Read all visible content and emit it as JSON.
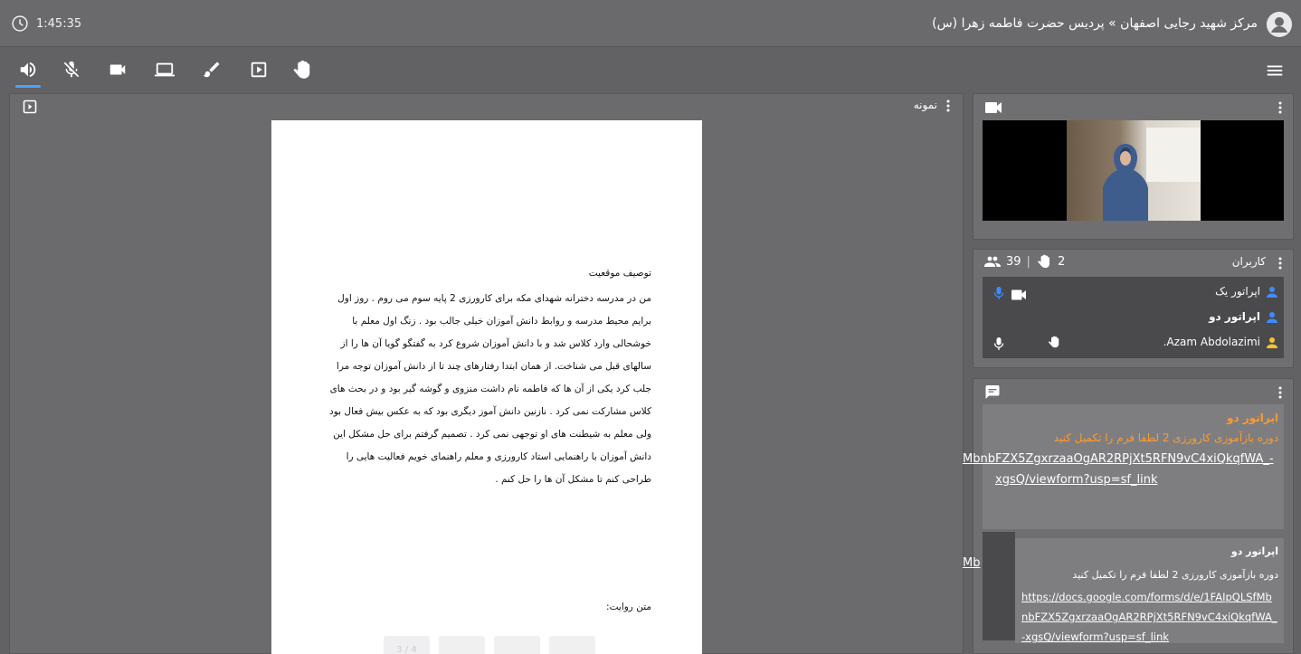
{
  "header": {
    "timer": "1:45:35",
    "room_title": "مرکز شهید رجایی اصفهان » پردیس حضرت فاطمه زهرا (س)"
  },
  "colors": {
    "accent": "#4aa3ff",
    "chat_highlight": "#ff9a2e",
    "user_icon_blue": "#3d8bff",
    "user_icon_yellow": "#f4c430"
  },
  "toolbar": {
    "icons": [
      "speaker-icon",
      "mic-off-icon",
      "camera-icon",
      "screen-share-icon",
      "brush-icon",
      "play-box-icon",
      "raise-hand-icon",
      "menu-icon"
    ]
  },
  "presentation": {
    "title": "نمونه",
    "heading": "توصیف موقعیت",
    "lines": [
      "من در مدرسه دخترانه شهدای مکه برای کارورزی 2 پایه سوم می روم . روز اول",
      "برایم محیط مدرسه و روابط دانش آموزان خیلی جالب بود . زنگ اول معلم با",
      "خوشحالی وارد کلاس شد و با دانش آموزان شروع کرد به گفتگو گویا آن ها را از",
      "سالهای قبل می شناخت. از همان ابتدا رفتارهای چند تا از دانش آموزان توجه مرا",
      "جلب کرد یکی از آن ها که فاطمه نام داشت منزوی و گوشه گیر بود و در بحث های",
      "کلاس مشارکت نمی کرد . نازنین دانش آموز دیگری بود که به عکس بیش فعال بود",
      "ولی معلم به شیطنت های او توجهی نمی کرد . تصمیم گرفتم برای حل مشکل این",
      "دانش آموزان با راهنمایی استاد کارورزی و معلم راهنمای خویم فعالیت هایی را",
      "طراحی کنم تا مشکل آن ها را حل کنم ."
    ],
    "footer": "متن روایت:",
    "page_indicator": "3 / 4"
  },
  "users": {
    "title": "کاربران",
    "raised_hands": "2",
    "count": "39",
    "list": [
      {
        "name": "اپراتور یک",
        "icon_color": "#3d8bff"
      },
      {
        "name": "اپراتور دو",
        "icon_color": "#3d8bff"
      },
      {
        "name": "Azam Abdolazimi.",
        "icon_color": "#f4c430"
      }
    ]
  },
  "chat": {
    "msg1": {
      "sender": "اپراتور دو",
      "text": "دوره بازآموزی کارورزی 2 لطفا فرم را تکمیل کنید",
      "link_line1": "MbnbFZX5ZgxrzaaOgAR2RPjXt5RFN9vC4xiQkqfWA_-",
      "link_line2": "xgsQ/viewform?usp=sf_link",
      "link_stub": "Mb"
    },
    "msg2": {
      "sender": "اپراتور دو",
      "text": "دوره بازآموزی کارورزی 2 لطفا فرم را تکمیل کنید",
      "link": "https://docs.google.com/forms/d/e/1FAIpQLSfMbnbFZX5ZgxrzaaOgAR2RPjXt5RFN9vC4xiQkqfWA_-xgsQ/viewform?usp=sf_link"
    }
  }
}
